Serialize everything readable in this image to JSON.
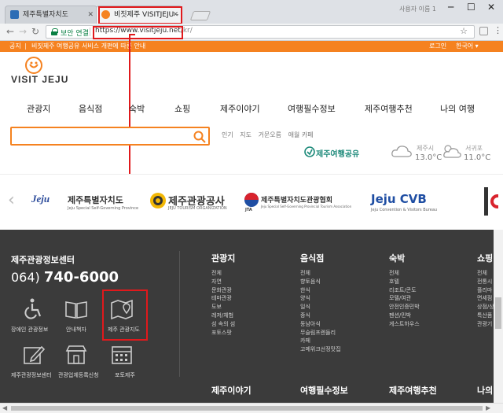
{
  "browser": {
    "tabs": [
      {
        "title": "제주특별자치도",
        "active": false
      },
      {
        "title": "비짓제주 VISITJEJU - 제",
        "active": true
      }
    ],
    "profile_name": "사용자 이름 1",
    "secure_label": "보안 연결",
    "url_main": "https://www.visitjeju.net",
    "url_rest": "/kr/",
    "window_controls": [
      "─",
      "☐",
      "✕"
    ]
  },
  "notice": {
    "label": "공지",
    "text": "비짓제주 여행공유 서비스 개편에 따른 안내",
    "login": "로그인",
    "language": "한국어"
  },
  "site": {
    "logo_text": "VISIT JEJU",
    "nav": [
      "관광지",
      "음식점",
      "숙박",
      "쇼핑",
      "제주이야기",
      "여행필수정보",
      "제주여행추천",
      "나의 여행"
    ],
    "search_placeholder": "",
    "quick_links": [
      "인기",
      "지도",
      "거문오름",
      "애월 카페"
    ],
    "share_label": "제주여행공유",
    "weather": [
      {
        "city": "제주시",
        "temp": "13.0°C"
      },
      {
        "city": "서귀포",
        "temp": "11.0°C"
      }
    ]
  },
  "partners": [
    {
      "mark": "Jeju",
      "name": "제주특별자치도",
      "sub": "Jeju Special Self-Governing Province"
    },
    {
      "mark": "",
      "name": "제주관광공사",
      "sub": "JEJU TOURISM ORGANIZATION"
    },
    {
      "mark": "JTA",
      "name": "제주특별자치도관광협회",
      "sub": "Jeju Special Self-Governing Provincial Tourism Association"
    },
    {
      "mark": "Jeju CVB",
      "name": "",
      "sub": "Jeju Convention & Visitors Bureau"
    }
  ],
  "footer": {
    "center_title": "제주관광정보센터",
    "phone_prefix": "064)",
    "phone_number": "740-6000",
    "shortcuts": [
      {
        "icon": "wheelchair-icon",
        "label": "장애인 관광정보"
      },
      {
        "icon": "book-icon",
        "label": "안내책자"
      },
      {
        "icon": "map-pin-icon",
        "label": "제주 관광지도"
      },
      {
        "icon": "edit-icon",
        "label": "제주관광정보센터"
      },
      {
        "icon": "store-icon",
        "label": "관광업체등록신청"
      },
      {
        "icon": "calendar-icon",
        "label": "포토제주"
      }
    ],
    "columns": [
      {
        "title": "관광지",
        "items": [
          "전체",
          "자연",
          "문화관광",
          "테마관광",
          "도보",
          "레저/체험",
          "섬 속의 섬",
          "포토스팟"
        ]
      },
      {
        "title": "음식점",
        "items": [
          "전체",
          "향토음식",
          "한식",
          "양식",
          "일식",
          "중식",
          "동남아식",
          "무슬림프렌들리",
          "카페",
          "고메위크선정맛집"
        ]
      },
      {
        "title": "숙박",
        "items": [
          "전체",
          "호텔",
          "리조트/콘도",
          "모텔/여관",
          "안전인증민박",
          "펜션/민박",
          "게스트하우스"
        ]
      },
      {
        "title": "쇼핑",
        "items": [
          "전체",
          "전통시",
          "플리마",
          "면세점",
          "상점/상",
          "특산품",
          "관광기"
        ]
      }
    ],
    "columns_bottom": [
      "제주이야기",
      "여행필수정보",
      "제주여행추천",
      "나의"
    ]
  },
  "colors": {
    "accent": "#f58220",
    "footer_bg": "#3b3b3b",
    "highlight": "#e0191c",
    "secure": "#0b8043"
  }
}
